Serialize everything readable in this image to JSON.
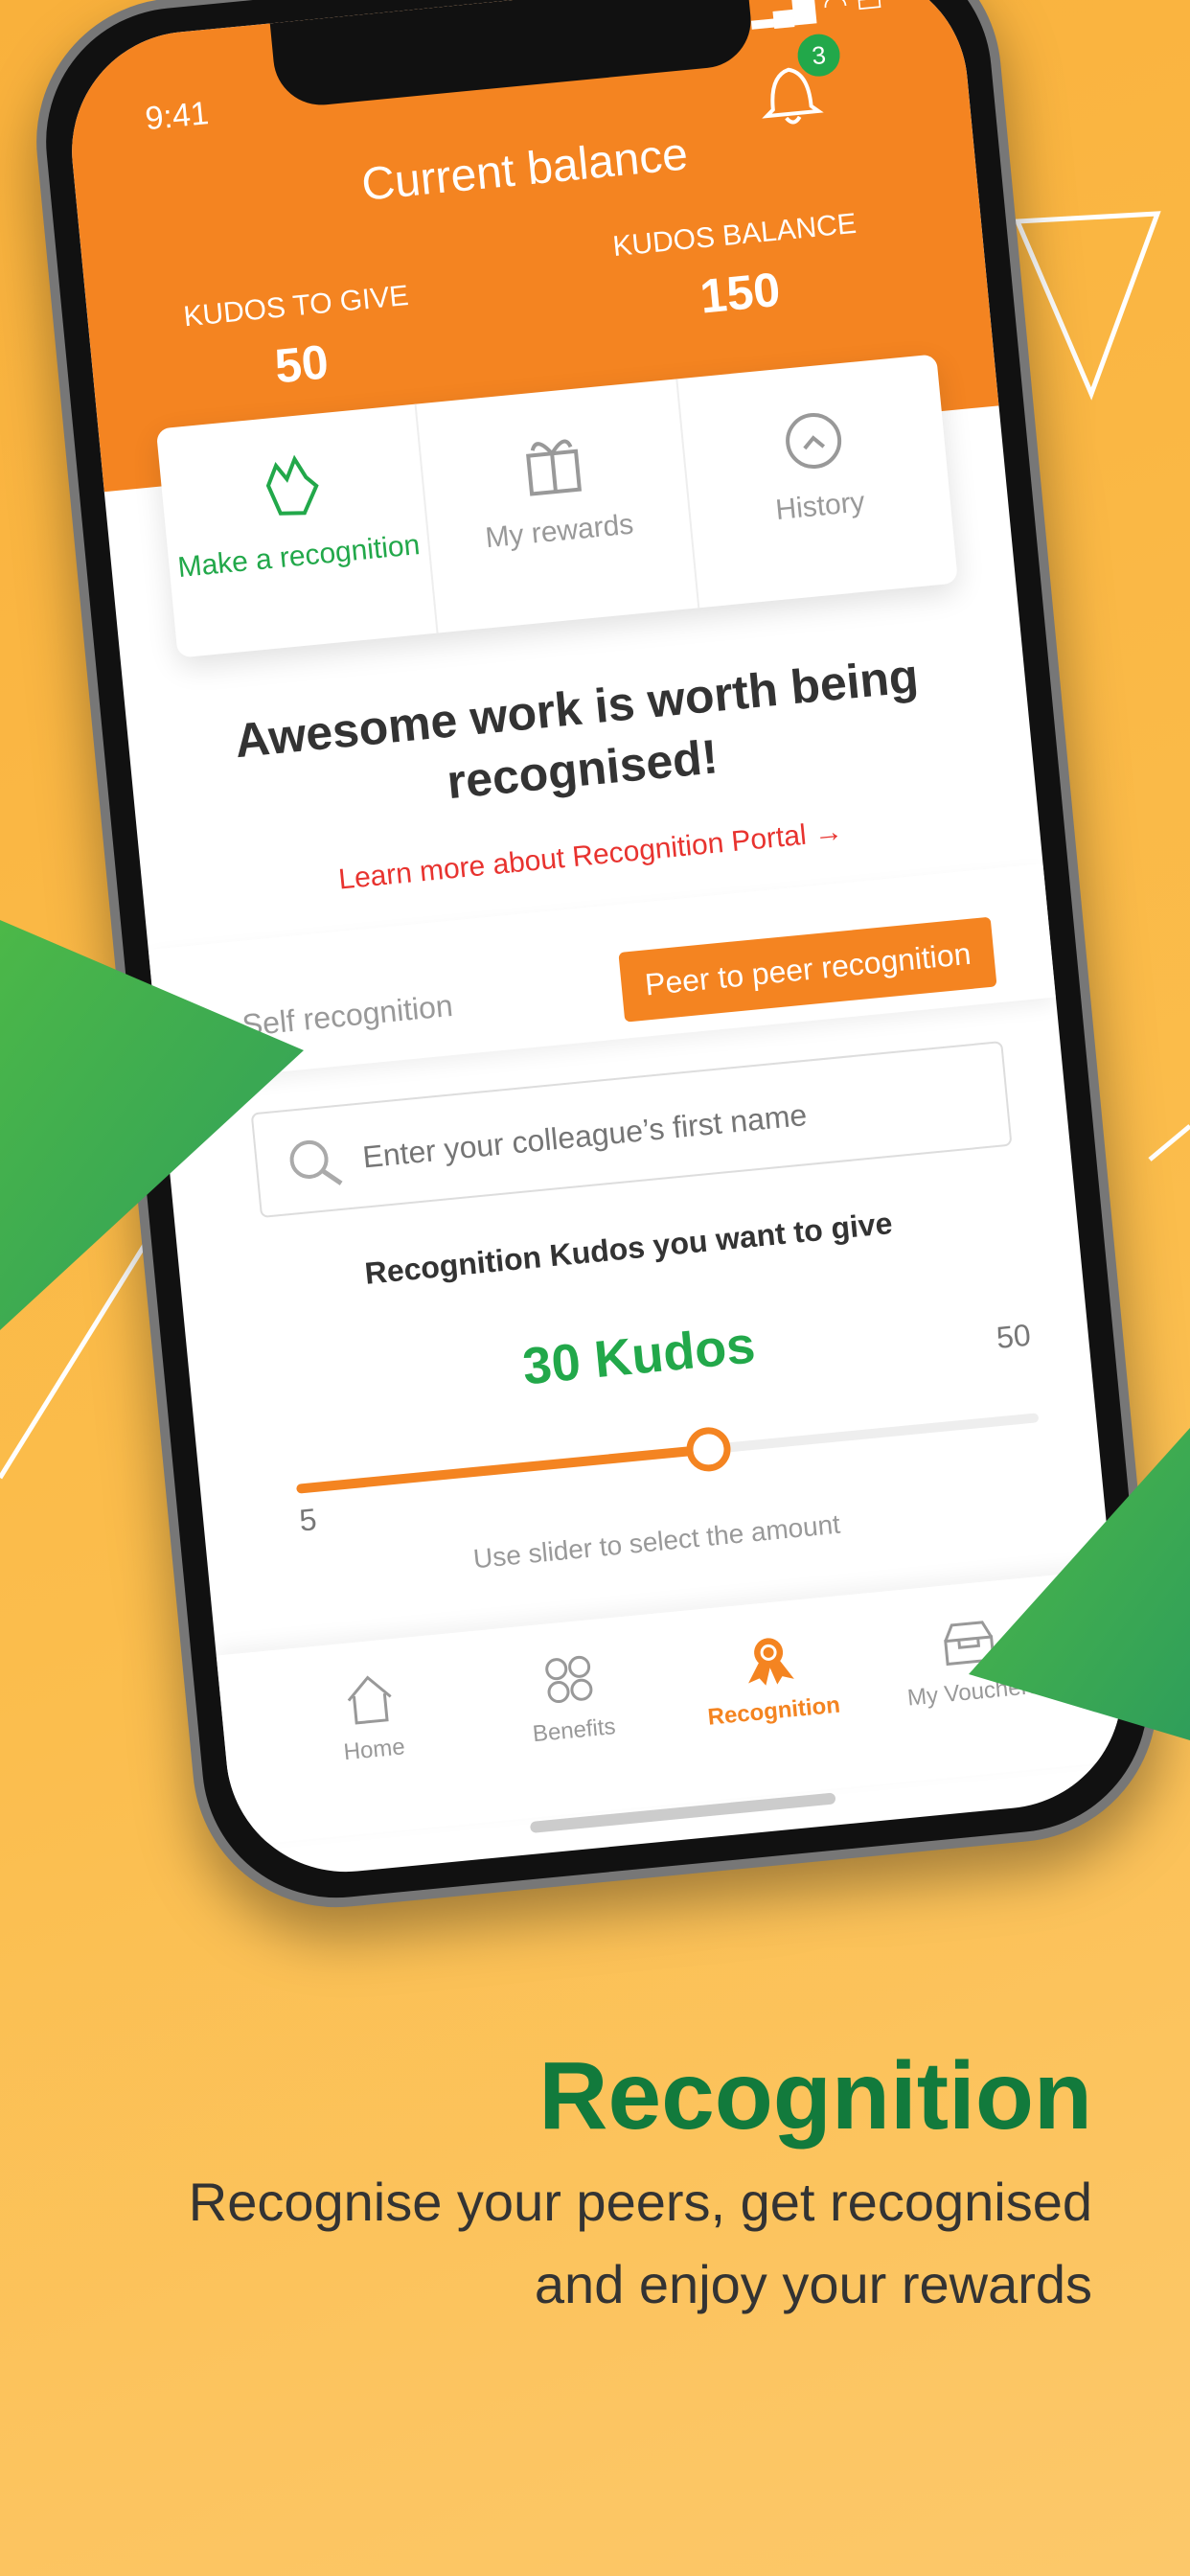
{
  "status_bar": {
    "time": "9:41"
  },
  "header": {
    "title": "Current balance",
    "notifications_count": "3",
    "kudos_to_give_label": "KUDOS TO GIVE",
    "kudos_to_give": "50",
    "kudos_balance_label": "KUDOS BALANCE",
    "kudos_balance": "150"
  },
  "tabs": [
    {
      "label": "Make a recognition",
      "icon": "clapping-hands-icon",
      "active": true
    },
    {
      "label": "My rewards",
      "icon": "gift-icon"
    },
    {
      "label": "History",
      "icon": "history-icon"
    }
  ],
  "headline": "Awesome work is worth being recognised!",
  "link": "Learn more about Recognition Portal →",
  "segment": {
    "self": "Self recognition",
    "peer": "Peer to peer recognition",
    "selected": "peer"
  },
  "search": {
    "placeholder": "Enter your colleague’s first name"
  },
  "kudos": {
    "label": "Recognition Kudos you want to give",
    "value_text": "30 Kudos",
    "value": 30,
    "min": "5",
    "max": "50",
    "hint": "Use slider to select the amount"
  },
  "nav": [
    {
      "label": "Home",
      "icon": "home-icon"
    },
    {
      "label": "Benefits",
      "icon": "benefits-icon"
    },
    {
      "label": "Recognition",
      "icon": "award-icon",
      "active": true
    },
    {
      "label": "My Vouchers",
      "icon": "vouchers-icon"
    }
  ],
  "promo": {
    "title": "Recognition",
    "subtitle_line1": "Recognise your peers, get recognised",
    "subtitle_line2": "and enjoy your rewards"
  },
  "colors": {
    "orange": "#f48421",
    "green": "#22a84a",
    "brand_green": "#127a3c",
    "background": "#fbbd4c"
  }
}
